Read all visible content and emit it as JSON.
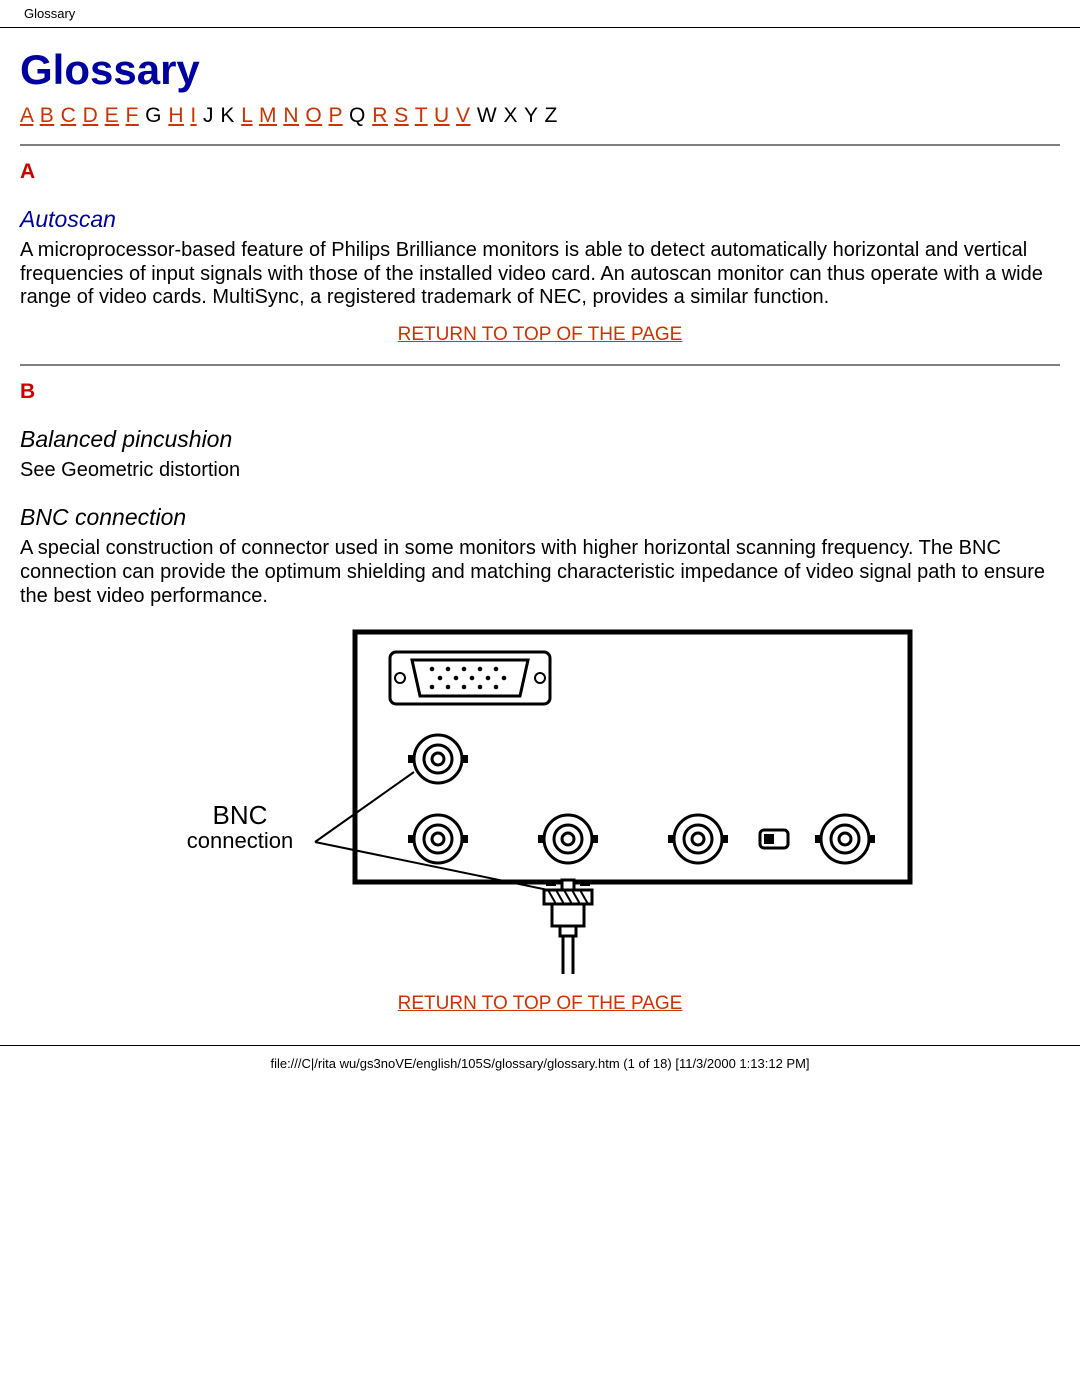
{
  "header": {
    "title": "Glossary"
  },
  "page_title": "Glossary",
  "alpha_index": [
    {
      "label": "A",
      "link": true
    },
    {
      "label": "B",
      "link": true
    },
    {
      "label": "C",
      "link": true
    },
    {
      "label": "D",
      "link": true
    },
    {
      "label": "E",
      "link": true
    },
    {
      "label": "F",
      "link": true
    },
    {
      "label": "G",
      "link": false
    },
    {
      "label": "H",
      "link": true
    },
    {
      "label": "I",
      "link": true
    },
    {
      "label": "J",
      "link": false
    },
    {
      "label": "K",
      "link": false
    },
    {
      "label": "L",
      "link": true
    },
    {
      "label": "M",
      "link": true
    },
    {
      "label": "N",
      "link": true
    },
    {
      "label": "O",
      "link": true
    },
    {
      "label": "P",
      "link": true
    },
    {
      "label": "Q",
      "link": false
    },
    {
      "label": "R",
      "link": true
    },
    {
      "label": "S",
      "link": true
    },
    {
      "label": "T",
      "link": true
    },
    {
      "label": "U",
      "link": true
    },
    {
      "label": "V",
      "link": true
    },
    {
      "label": "W",
      "link": false
    },
    {
      "label": "X",
      "link": false
    },
    {
      "label": "Y",
      "link": false
    },
    {
      "label": "Z",
      "link": false
    }
  ],
  "section_a": {
    "letter": "A",
    "term1": "Autoscan",
    "term1_body": "A microprocessor-based feature of Philips Brilliance monitors is able to detect automatically horizontal and vertical frequencies of input signals with those of the installed video card. An autoscan monitor can thus operate with a wide range of video cards. MultiSync, a registered trademark of NEC, provides a similar function.",
    "return": "RETURN TO TOP OF THE PAGE"
  },
  "section_b": {
    "letter": "B",
    "term1": "Balanced pincushion",
    "term1_body": "See Geometric distortion",
    "term2": "BNC connection",
    "term2_body": "A special construction of connector used in some monitors with higher horizontal scanning frequency. The BNC connection can provide the optimum shielding and matching characteristic impedance of video signal path to ensure the best video performance.",
    "diagram_label1": "BNC",
    "diagram_label2": "connection",
    "return": "RETURN TO TOP OF THE PAGE"
  },
  "footer": {
    "text": "file:///C|/rita wu/gs3noVE/english/105S/glossary/glossary.htm (1 of 18) [11/3/2000 1:13:12 PM]"
  }
}
